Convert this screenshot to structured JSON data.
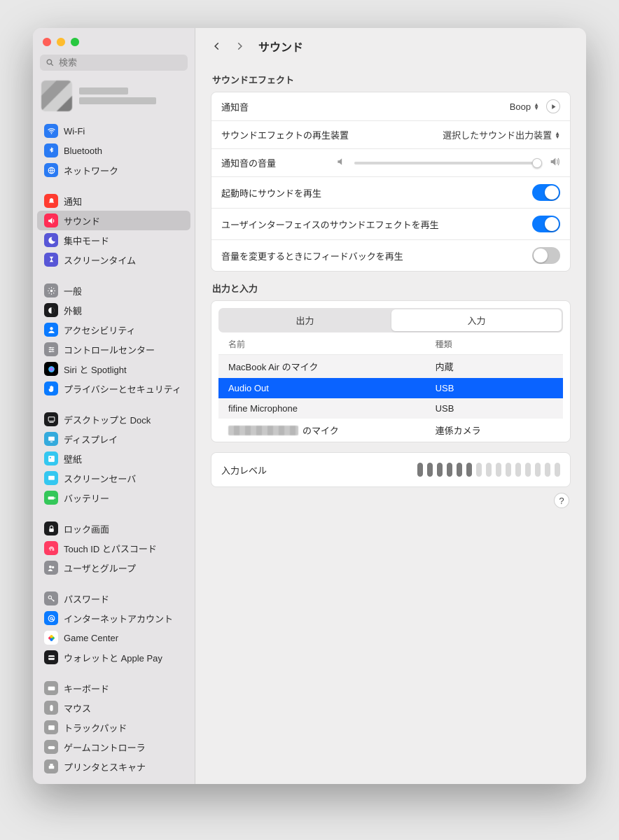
{
  "search": {
    "placeholder": "検索"
  },
  "sidebar": {
    "groups": [
      [
        {
          "label": "Wi-Fi",
          "color": "#2a7af3",
          "icon": "wifi"
        },
        {
          "label": "Bluetooth",
          "color": "#2a7af3",
          "icon": "bt"
        },
        {
          "label": "ネットワーク",
          "color": "#2a7af3",
          "icon": "globe"
        }
      ],
      [
        {
          "label": "通知",
          "color": "#ff3b30",
          "icon": "bell"
        },
        {
          "label": "サウンド",
          "color": "#ff2d55",
          "icon": "speaker",
          "selected": true
        },
        {
          "label": "集中モード",
          "color": "#5856d6",
          "icon": "moon"
        },
        {
          "label": "スクリーンタイム",
          "color": "#5856d6",
          "icon": "hourglass"
        }
      ],
      [
        {
          "label": "一般",
          "color": "#8e8e93",
          "icon": "gear"
        },
        {
          "label": "外観",
          "color": "#1c1c1e",
          "icon": "appearance"
        },
        {
          "label": "アクセシビリティ",
          "color": "#0a7aff",
          "icon": "person"
        },
        {
          "label": "コントロールセンター",
          "color": "#8e8e93",
          "icon": "sliders"
        },
        {
          "label": "Siri と Spotlight",
          "color": "#000000",
          "icon": "siri"
        },
        {
          "label": "プライバシーとセキュリティ",
          "color": "#0a7aff",
          "icon": "hand"
        }
      ],
      [
        {
          "label": "デスクトップと Dock",
          "color": "#1c1c1e",
          "icon": "dock"
        },
        {
          "label": "ディスプレイ",
          "color": "#34aadc",
          "icon": "display"
        },
        {
          "label": "壁紙",
          "color": "#34c7f0",
          "icon": "wallpaper"
        },
        {
          "label": "スクリーンセーバ",
          "color": "#34c7f0",
          "icon": "screensaver"
        },
        {
          "label": "バッテリー",
          "color": "#34c759",
          "icon": "battery"
        }
      ],
      [
        {
          "label": "ロック画面",
          "color": "#1c1c1e",
          "icon": "lock"
        },
        {
          "label": "Touch ID とパスコード",
          "color": "#ff3b62",
          "icon": "touchid"
        },
        {
          "label": "ユーザとグループ",
          "color": "#8e8e93",
          "icon": "users"
        }
      ],
      [
        {
          "label": "パスワード",
          "color": "#8e8e93",
          "icon": "key"
        },
        {
          "label": "インターネットアカウント",
          "color": "#0a7aff",
          "icon": "at"
        },
        {
          "label": "Game Center",
          "color": "#ffffff",
          "icon": "gamecenter"
        },
        {
          "label": "ウォレットと Apple Pay",
          "color": "#1c1c1e",
          "icon": "wallet"
        }
      ],
      [
        {
          "label": "キーボード",
          "color": "#9e9e9e",
          "icon": "keyboard"
        },
        {
          "label": "マウス",
          "color": "#9e9e9e",
          "icon": "mouse"
        },
        {
          "label": "トラックパッド",
          "color": "#9e9e9e",
          "icon": "trackpad"
        },
        {
          "label": "ゲームコントローラ",
          "color": "#9e9e9e",
          "icon": "controller"
        },
        {
          "label": "プリンタとスキャナ",
          "color": "#9e9e9e",
          "icon": "printer"
        }
      ]
    ]
  },
  "header": {
    "title": "サウンド"
  },
  "effects": {
    "section_label": "サウンドエフェクト",
    "alert_label": "通知音",
    "alert_value": "Boop",
    "play_device_label": "サウンドエフェクトの再生装置",
    "play_device_value": "選択したサウンド出力装置",
    "alert_volume_label": "通知音の音量",
    "alert_volume_percent": 98,
    "startup_label": "起動時にサウンドを再生",
    "startup_on": true,
    "ui_effects_label": "ユーザインターフェイスのサウンドエフェクトを再生",
    "ui_effects_on": true,
    "feedback_label": "音量を変更するときにフィードバックを再生",
    "feedback_on": false
  },
  "io": {
    "section_label": "出力と入力",
    "tab_output": "出力",
    "tab_input": "入力",
    "active_tab": "input",
    "col_name": "名前",
    "col_type": "種類",
    "devices": [
      {
        "name": "MacBook Air のマイク",
        "type": "内蔵",
        "selected": false,
        "redacted": false
      },
      {
        "name": "Audio Out",
        "type": "USB",
        "selected": true,
        "redacted": false
      },
      {
        "name": "fifine Microphone",
        "type": "USB",
        "selected": false,
        "redacted": false
      },
      {
        "name": "のマイク",
        "type": "連係カメラ",
        "selected": false,
        "redacted": true
      }
    ],
    "level_label": "入力レベル",
    "level_bars_total": 15,
    "level_bars_active": 6
  }
}
